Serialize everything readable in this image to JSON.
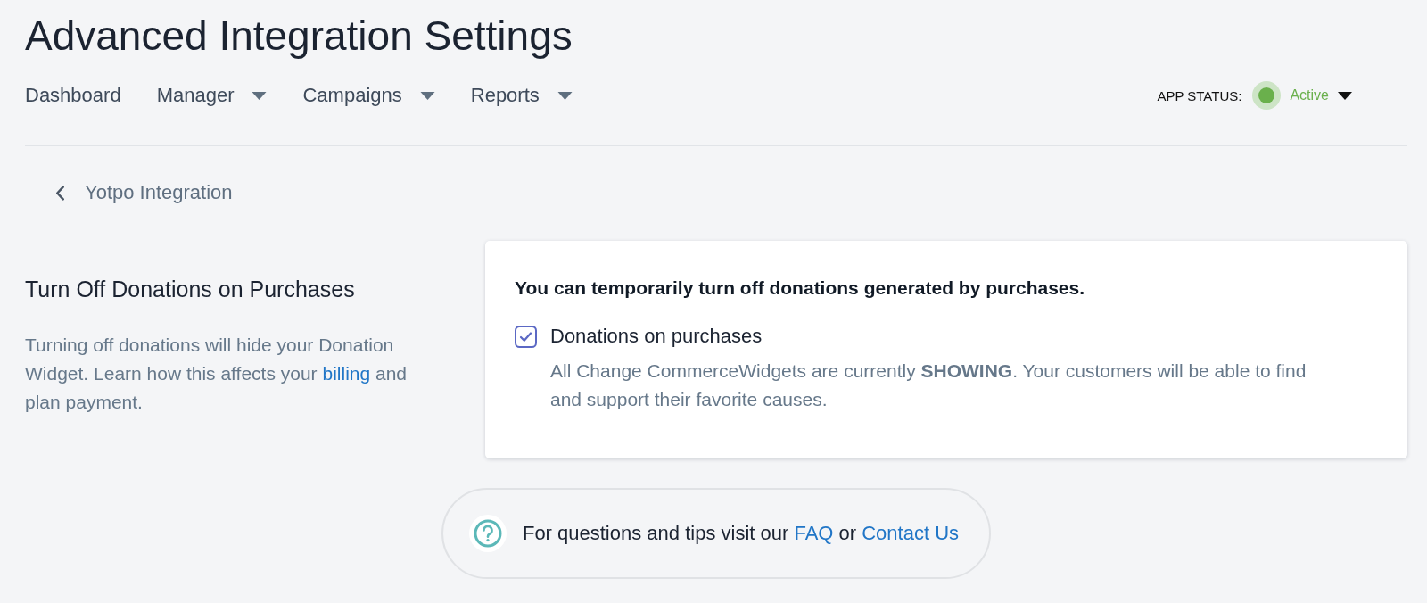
{
  "page": {
    "title": "Advanced Integration Settings"
  },
  "nav": [
    {
      "label": "Dashboard",
      "has_menu": false
    },
    {
      "label": "Manager",
      "has_menu": true
    },
    {
      "label": "Campaigns",
      "has_menu": true
    },
    {
      "label": "Reports",
      "has_menu": true
    }
  ],
  "app_status": {
    "label": "APP STATUS:",
    "value": "Active",
    "active": true
  },
  "back_link": {
    "label": "Yotpo Integration"
  },
  "section": {
    "title": "Turn Off Donations on Purchases",
    "description": [
      {
        "kind": "text",
        "text": "Turning off donations will hide your Donation Widget. Learn how this affects your "
      },
      {
        "kind": "link",
        "text": "billing"
      },
      {
        "kind": "text",
        "text": " and plan payment."
      }
    ]
  },
  "card": {
    "heading": "You can temporarily turn off donations generated by purchases.",
    "option": {
      "label": "Donations on purchases",
      "checked": true,
      "description": "All Change CommerceWidgets are currently **SHOWING**. Your customers will be able to find and support their favorite causes."
    }
  },
  "help": {
    "parts": [
      {
        "kind": "text",
        "text": "For questions and tips visit our "
      },
      {
        "kind": "link",
        "text": "FAQ"
      },
      {
        "kind": "text",
        "text": " or "
      },
      {
        "kind": "link",
        "text": "Contact Us"
      }
    ]
  }
}
